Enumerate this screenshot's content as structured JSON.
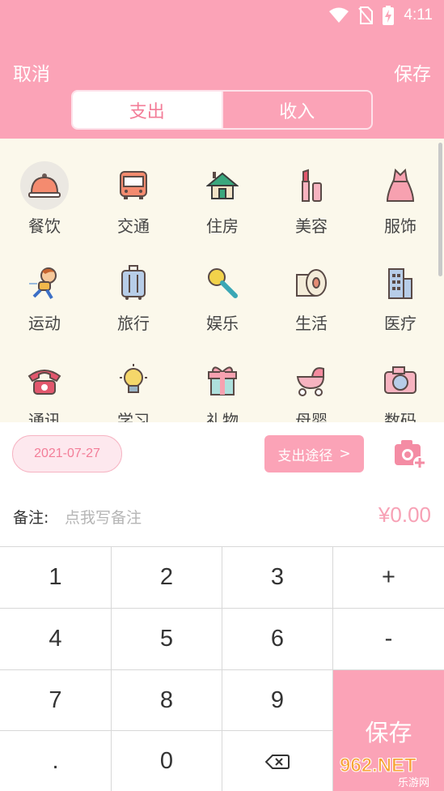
{
  "status_bar": {
    "time": "4:11"
  },
  "header": {
    "cancel_label": "取消",
    "save_label": "保存",
    "tabs": [
      {
        "label": "支出"
      },
      {
        "label": "收入"
      }
    ]
  },
  "categories": [
    {
      "label": "餐饮",
      "icon": "dining-bell-icon"
    },
    {
      "label": "交通",
      "icon": "bus-icon"
    },
    {
      "label": "住房",
      "icon": "house-icon"
    },
    {
      "label": "美容",
      "icon": "lipstick-icon"
    },
    {
      "label": "服饰",
      "icon": "dress-icon"
    },
    {
      "label": "运动",
      "icon": "running-boy-icon"
    },
    {
      "label": "旅行",
      "icon": "suitcase-icon"
    },
    {
      "label": "娱乐",
      "icon": "microphone-icon"
    },
    {
      "label": "生活",
      "icon": "toilet-paper-icon"
    },
    {
      "label": "医疗",
      "icon": "hospital-icon"
    },
    {
      "label": "通讯",
      "icon": "telephone-icon"
    },
    {
      "label": "学习",
      "icon": "lightbulb-icon"
    },
    {
      "label": "礼物",
      "icon": "gift-icon"
    },
    {
      "label": "母婴",
      "icon": "stroller-icon"
    },
    {
      "label": "数码",
      "icon": "camera-icon"
    }
  ],
  "entry": {
    "date": "2021-07-27",
    "payment_label": "支出途径",
    "payment_arrow": ">",
    "note_label": "备注:",
    "note_placeholder": "点我写备注",
    "amount": "¥0.00"
  },
  "keypad": {
    "keys": [
      "1",
      "2",
      "3",
      "+",
      "4",
      "5",
      "6",
      "-",
      "7",
      "8",
      "9",
      ".",
      "0"
    ],
    "save_label": "保存"
  },
  "watermark": {
    "big": "962.NET",
    "small": "乐游网"
  },
  "colors": {
    "accent": "#fba3b7",
    "accent_text": "#f37d98",
    "grid_bg": "#fbf8eb"
  }
}
